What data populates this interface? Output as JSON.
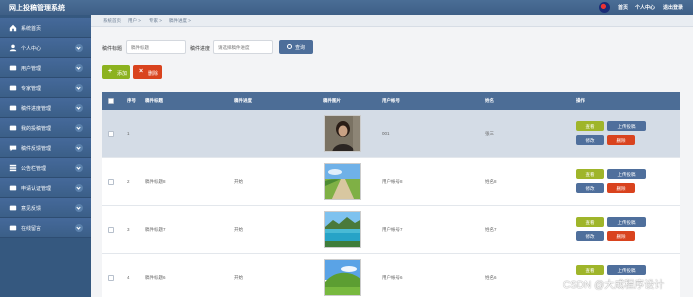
{
  "app": {
    "title": "网上投稿管理系统"
  },
  "topnav": {
    "home": "首页",
    "profile": "个人中心",
    "logout": "退出登录"
  },
  "sidebar": {
    "items": [
      {
        "label": "系统首页",
        "icon": "home-icon"
      },
      {
        "label": "个人中心",
        "icon": "user-icon"
      },
      {
        "label": "用户管理",
        "icon": "users-icon"
      },
      {
        "label": "专家管理",
        "icon": "expert-icon"
      },
      {
        "label": "稿件进度管理",
        "icon": "progress-icon"
      },
      {
        "label": "我的投稿管理",
        "icon": "manuscript-icon"
      },
      {
        "label": "稿件反馈管理",
        "icon": "feedback-icon"
      },
      {
        "label": "公告栏管理",
        "icon": "notice-icon"
      },
      {
        "label": "申请认证管理",
        "icon": "certification-icon"
      },
      {
        "label": "意见反馈",
        "icon": "opinion-icon"
      },
      {
        "label": "在线留言",
        "icon": "message-icon"
      }
    ]
  },
  "breadcrumb": {
    "home": "系统首页",
    "user": "用户 >",
    "expert": "专家 >",
    "current": "稿件进度 >"
  },
  "search": {
    "title_label": "稿件标题",
    "title_placeholder": "稿件标题",
    "progress_label": "稿件进度",
    "progress_placeholder": "请选择稿件进度",
    "button": "查询"
  },
  "toolbar": {
    "add": "添加",
    "delete": "删除"
  },
  "table": {
    "headers": [
      "序号",
      "稿件标题",
      "稿件进度",
      "稿件图片",
      "用户帐号",
      "姓名",
      "操作"
    ],
    "rows": [
      {
        "index": "1",
        "title": "",
        "progress": "",
        "image": "portrait",
        "account": "001",
        "name": "张三",
        "highlight": true
      },
      {
        "index": "2",
        "title": "稿件标题8",
        "progress": "开始",
        "image": "road",
        "account": "用户帐号8",
        "name": "姓名8",
        "highlight": false
      },
      {
        "index": "3",
        "title": "稿件标题7",
        "progress": "开始",
        "image": "lake",
        "account": "用户帐号7",
        "name": "姓名7",
        "highlight": false
      },
      {
        "index": "4",
        "title": "稿件标题6",
        "progress": "开始",
        "image": "hill",
        "account": "用户帐号6",
        "name": "姓名6",
        "highlight": false
      }
    ],
    "actions": {
      "view": "查看",
      "upload": "上传投稿",
      "edit": "修改",
      "delete": "删除"
    }
  },
  "watermark": "CSDN @大成程序设计",
  "colors": {
    "header": "#3e5f86",
    "sidebar": "#35587f",
    "add_button": "#8cb21f",
    "delete_button": "#d9431e",
    "action_blue": "#4f6f9c",
    "action_view": "#9fb52a",
    "highlight_row": "#d4dce6"
  }
}
